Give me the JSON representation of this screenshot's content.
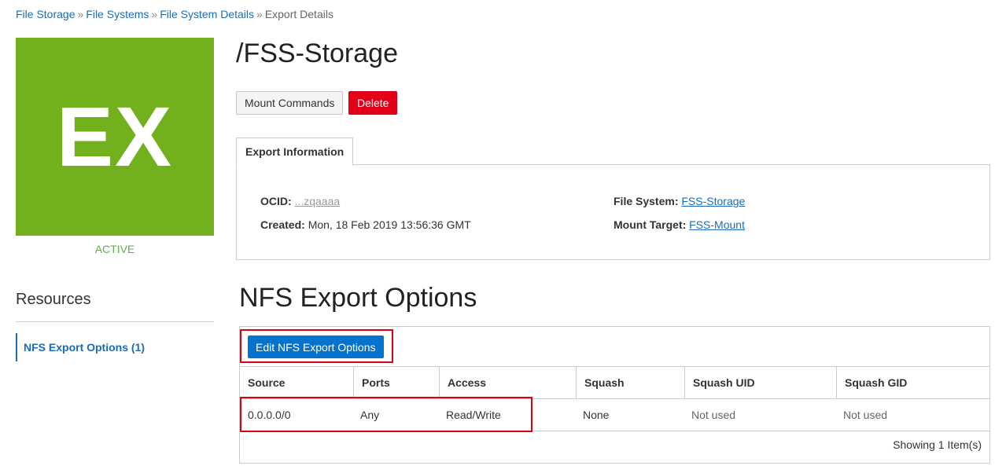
{
  "breadcrumb": {
    "items": [
      "File Storage",
      "File Systems",
      "File System Details"
    ],
    "separator": "»",
    "current": "Export Details"
  },
  "badge": {
    "text": "EX",
    "status": "ACTIVE",
    "color": "#72b01d"
  },
  "resources": {
    "title": "Resources",
    "items": [
      {
        "label": "NFS Export Options (1)"
      }
    ]
  },
  "page": {
    "title": "/FSS-Storage"
  },
  "actions": {
    "mount_label": "Mount Commands",
    "delete_label": "Delete"
  },
  "info": {
    "tab_label": "Export Information",
    "ocid_label": "OCID:",
    "ocid_value": "...zqaaaa",
    "created_label": "Created:",
    "created_value": "Mon, 18 Feb 2019 13:56:36 GMT",
    "fs_label": "File System:",
    "fs_value": "FSS-Storage",
    "mt_label": "Mount Target:",
    "mt_value": "FSS-Mount"
  },
  "nfs": {
    "title": "NFS Export Options",
    "edit_label": "Edit NFS Export Options",
    "columns": [
      "Source",
      "Ports",
      "Access",
      "Squash",
      "Squash UID",
      "Squash GID"
    ],
    "rows": [
      [
        "0.0.0.0/0",
        "Any",
        "Read/Write",
        "None",
        "Not used",
        "Not used"
      ]
    ],
    "footer": "Showing 1 Item(s)"
  },
  "colors": {
    "accent": "#1c6cb5",
    "primary_button": "#0572ce",
    "danger": "#e30018",
    "highlight": "#e00010"
  }
}
